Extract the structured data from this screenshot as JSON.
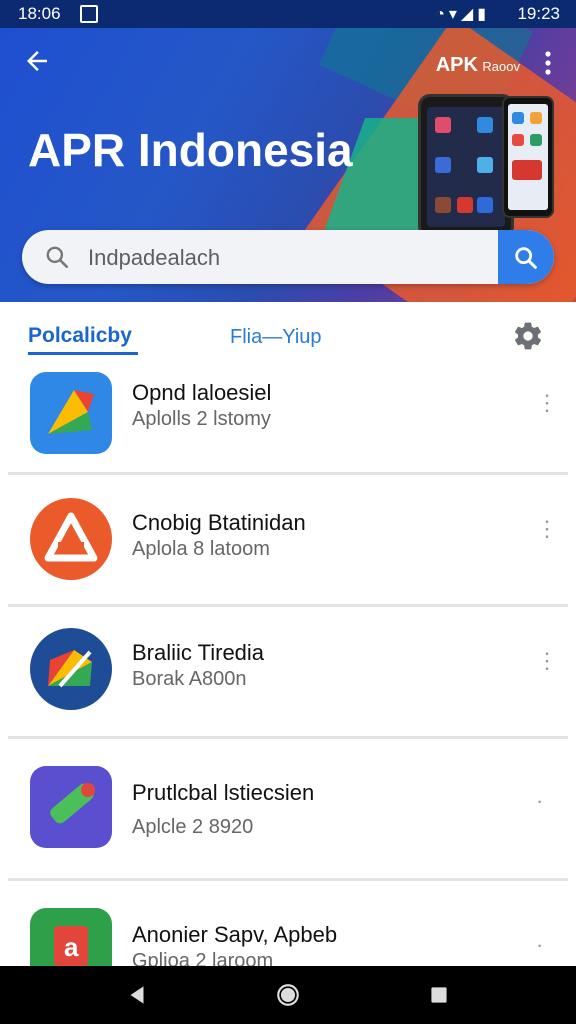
{
  "status_bar": {
    "time_left": "18:06",
    "time_right": "19:23"
  },
  "header": {
    "title": "APR Indonesia",
    "brand_bold": "APK",
    "brand_small": "Raoov"
  },
  "search": {
    "placeholder": "Indpadealach"
  },
  "tabs": {
    "tab1": "Polcalicby",
    "tab2": "Flia—Yiup"
  },
  "apps": [
    {
      "name": "Opnd laloesiel",
      "sub": "Aplolls 2 lstomy"
    },
    {
      "name": "Cnobig Btatinidan",
      "sub": "Aplola 8 latoom"
    },
    {
      "name": "Braliic Tiredia",
      "sub": "Borak A800n"
    },
    {
      "name": "Prutlcbal lstiecsien",
      "sub": "Aplcle 2 8920"
    },
    {
      "name": "Anonier Sapv, Apbeb",
      "sub": "Gplioa 2 laroom"
    }
  ],
  "icons": {
    "back": "arrow-left-icon",
    "more": "more-vert-icon",
    "search": "search-icon",
    "settings": "gear-icon"
  },
  "colors": {
    "accent": "#1a66d1",
    "search_button": "#2f7de8",
    "header_start": "#1f4fd0",
    "header_end": "#c64b3a"
  }
}
